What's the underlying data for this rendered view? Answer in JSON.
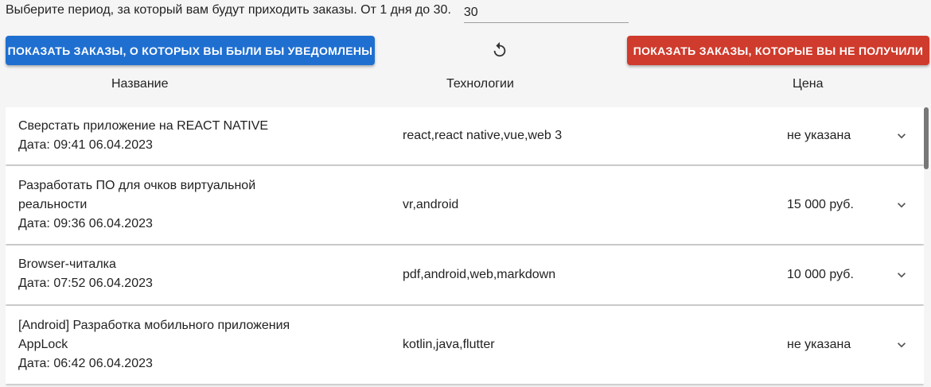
{
  "period": {
    "label": "Выберите период, за который вам будут приходить заказы. От 1 дня до 30.",
    "value": "30"
  },
  "buttons": {
    "show_notified": "ПОКАЗАТЬ ЗАКАЗЫ, О КОТОРЫХ ВЫ БЫЛИ БЫ УВЕДОМЛЕНЫ",
    "show_missed": "ПОКАЗАТЬ ЗАКАЗЫ, КОТОРЫЕ ВЫ НЕ ПОЛУЧИЛИ",
    "refresh_icon": "refresh-icon"
  },
  "colors": {
    "primary": "#1f6fd1",
    "danger": "#cf3b2c"
  },
  "table": {
    "columns": [
      "Название",
      "Технологии",
      "Цена"
    ],
    "rows": [
      {
        "title_lines": [
          "Сверстать приложение на REACT NATIVE"
        ],
        "date": "Дата: 09:41 06.04.2023",
        "tech": "react,react native,vue,web 3",
        "price": "не указана"
      },
      {
        "title_lines": [
          "Разработать ПО для очков виртуальной",
          "реальности"
        ],
        "date": "Дата: 09:36 06.04.2023",
        "tech": "vr,android",
        "price": "15 000 руб."
      },
      {
        "title_lines": [
          "Browser-читалка"
        ],
        "date": "Дата: 07:52 06.04.2023",
        "tech": "pdf,android,web,markdown",
        "price": "10 000 руб."
      },
      {
        "title_lines": [
          "[Android] Разработка мобильного приложения",
          "AppLock"
        ],
        "date": "Дата: 06:42 06.04.2023",
        "tech": "kotlin,java,flutter",
        "price": "не указана"
      }
    ]
  }
}
